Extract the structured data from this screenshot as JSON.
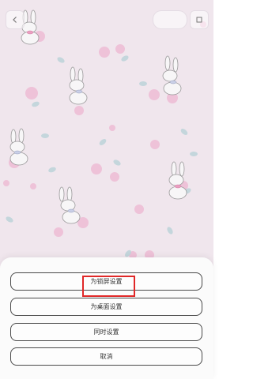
{
  "screen": {
    "title": "wallpaper-preview",
    "background_color": "#f8eef5"
  },
  "top_bar": {
    "back_icon": "chevron-left-icon",
    "actions_icon": "pill-menu",
    "square_icon": "square-icon"
  },
  "sheet": {
    "buttons": [
      {
        "label": "为锁屏设置"
      },
      {
        "label": "为桌面设置"
      },
      {
        "label": "同时设置"
      },
      {
        "label": "取消"
      }
    ],
    "highlight_color": "#e02828"
  }
}
